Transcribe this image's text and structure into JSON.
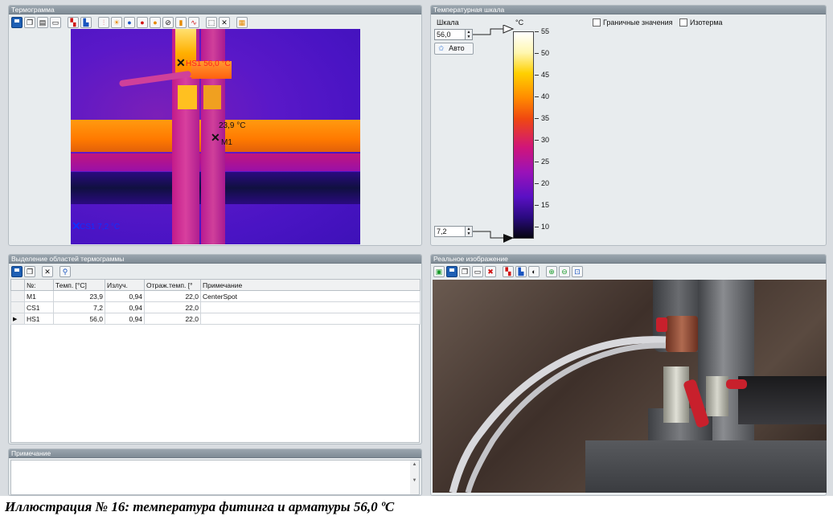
{
  "thermogram": {
    "title": "Термограмма",
    "toolbar_icons": [
      "save-icon",
      "copy-icon",
      "open-icon",
      "print-icon",
      "palette-icon",
      "region-icon",
      "thermometer-icon",
      "sun-icon",
      "blue-dot-icon",
      "red-dot-icon",
      "orange-dot-icon",
      "null-icon",
      "histogram-icon",
      "profile-icon",
      "select-icon",
      "delete-icon",
      "grid-icon"
    ],
    "markers": {
      "hs1_label": "HS1 56,0 °C",
      "m1_value": "23,9 °C",
      "m1_name": "M1",
      "cs1_label": "CS1 7,2 °C"
    }
  },
  "scale": {
    "title": "Температурная шкала",
    "scale_label": "Шкала",
    "max_value": "56,0",
    "min_value": "7,2",
    "auto_button": "Авто",
    "unit": "°C",
    "ticks": [
      "55",
      "50",
      "45",
      "40",
      "35",
      "30",
      "25",
      "20",
      "15",
      "10"
    ],
    "checkbox_limits": "Граничные значения",
    "checkbox_isotherm": "Изотерма"
  },
  "regions": {
    "title": "Выделение областей термограммы",
    "columns": [
      "№:",
      "Темп. [°C]",
      "Излуч.",
      "Отраж.темп. [°",
      "Примечание"
    ],
    "rows": [
      {
        "name": "M1",
        "temp": "23,9",
        "emissivity": "0,94",
        "reflected": "22,0",
        "note": "CenterSpot"
      },
      {
        "name": "CS1",
        "temp": "7,2",
        "emissivity": "0,94",
        "reflected": "22,0",
        "note": ""
      },
      {
        "name": "HS1",
        "temp": "56,0",
        "emissivity": "0,94",
        "reflected": "22,0",
        "note": ""
      }
    ]
  },
  "note_panel": {
    "title": "Примечание"
  },
  "real_image": {
    "title": "Реальное изображение"
  },
  "caption": "Иллюстрация № 16: температура фитинга и арматуры 56,0 ºC",
  "colors": {
    "panel_header": "#8a959e",
    "hot_marker": "#ff2020",
    "cold_marker": "#1030ff"
  }
}
